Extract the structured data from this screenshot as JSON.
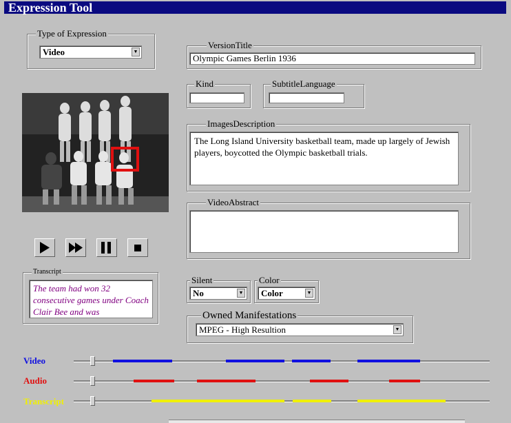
{
  "window": {
    "title": "Expression Tool"
  },
  "type_of_expression": {
    "legend": "Type of Expression",
    "value": "Video"
  },
  "version_title": {
    "legend": "VersionTitle",
    "value": "Olympic Games Berlin 1936"
  },
  "kind": {
    "legend": "Kind",
    "value": ""
  },
  "subtitle_language": {
    "legend": "SubtitleLanguage",
    "value": ""
  },
  "images_description": {
    "legend": "ImagesDescription",
    "value": "The Long Island University basketball team, made up largely of Jewish players, boycotted the Olympic basketball trials."
  },
  "video_abstract": {
    "legend": "VideoAbstract",
    "value": ""
  },
  "player": {
    "buttons": [
      "play-icon",
      "fast-forward-icon",
      "pause-icon",
      "stop-icon"
    ]
  },
  "transcript": {
    "legend": "Transcript",
    "value": "The team had won 32 consecutive games under Coach Clair Bee and was"
  },
  "silent": {
    "legend": "Silent",
    "value": "No"
  },
  "color": {
    "legend": "Color",
    "value": "Color"
  },
  "owned_manifestations": {
    "legend": "Owned Manifestations",
    "value": "MPEG - High Resultion"
  },
  "timeline": {
    "tracks": [
      {
        "label": "Video",
        "color": "#1010e0"
      },
      {
        "label": "Audio",
        "color": "#e01010"
      },
      {
        "label": "Transcript",
        "color": "#f0f000"
      }
    ]
  }
}
